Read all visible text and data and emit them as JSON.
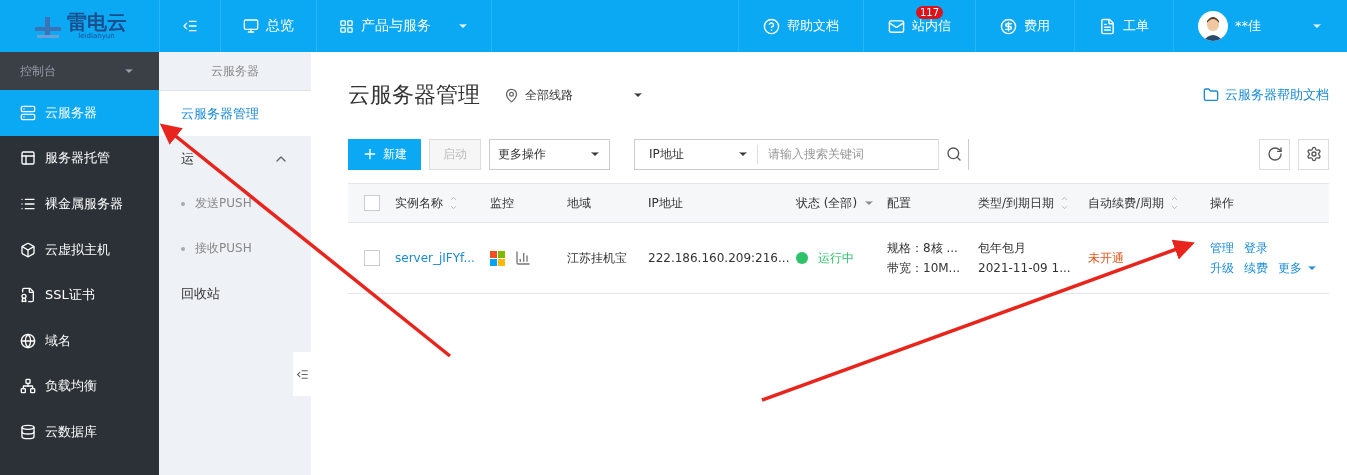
{
  "topbar": {
    "logo": {
      "name": "雷电云",
      "sub": "leidianyun"
    },
    "nav": [
      {
        "kind": "toggle"
      },
      {
        "kind": "link",
        "label": "总览"
      },
      {
        "kind": "dropdown",
        "label": "产品与服务"
      }
    ],
    "right": [
      {
        "label": "帮助文档"
      },
      {
        "label": "站内信",
        "badge": "117"
      },
      {
        "label": "费用"
      },
      {
        "label": "工单"
      }
    ],
    "user": {
      "name": "**佳"
    }
  },
  "sidebar": {
    "header": "控制台",
    "items": [
      {
        "label": "云服务器",
        "selected": true
      },
      {
        "label": "服务器托管",
        "selected": false
      },
      {
        "label": "裸金属服务器",
        "selected": false
      },
      {
        "label": "云虚拟主机",
        "selected": false
      },
      {
        "label": "SSL证书",
        "selected": false
      },
      {
        "label": "域名",
        "selected": false
      },
      {
        "label": "负载均衡",
        "selected": false
      },
      {
        "label": "云数据库",
        "selected": false
      }
    ]
  },
  "subnav": {
    "title": "云服务器",
    "items": [
      {
        "kind": "link",
        "label": "云服务器管理",
        "selected": true
      },
      {
        "kind": "group",
        "label": "运",
        "expanded": true,
        "children": [
          {
            "label": "发送PUSH"
          },
          {
            "label": "接收PUSH"
          }
        ]
      },
      {
        "kind": "link",
        "label": "回收站",
        "selected": false
      }
    ]
  },
  "main": {
    "title": "云服务器管理",
    "region": "全部线路",
    "help_link": "云服务器帮助文档",
    "toolbar": {
      "create": "新建",
      "start": {
        "label": "启动",
        "disabled": true
      },
      "more": "更多操作",
      "filter": "IP地址",
      "search": {
        "placeholder": "请输入搜索关键词"
      }
    },
    "table": {
      "select_all": {
        "checked": false
      },
      "columns": [
        {
          "label": "实例名称",
          "sortable": true
        },
        {
          "label": "监控",
          "sortable": false
        },
        {
          "label": "地域",
          "sortable": false
        },
        {
          "label": "IP地址",
          "sortable": false
        },
        {
          "label": "状态 (全部)",
          "sortable": false,
          "filter": true
        },
        {
          "label": "配置",
          "sortable": false
        },
        {
          "label": "类型/到期日期",
          "sortable": true
        },
        {
          "label": "自动续费/周期",
          "sortable": true
        },
        {
          "label": "操作",
          "sortable": false
        }
      ],
      "rows": [
        {
          "checked": false,
          "name": "server_jIFYf...",
          "region": "江苏挂机宝",
          "ip": "222.186.160.209:216...",
          "status": {
            "label": "运行中",
            "color": "#2ec26a"
          },
          "config": [
            "规格：8核 ...",
            "带宽：10M..."
          ],
          "type": [
            "包年包月",
            "2021-11-09 1..."
          ],
          "renew": "未开通",
          "actions": [
            [
              {
                "label": "管理",
                "dropdown": false
              },
              {
                "label": "登录",
                "dropdown": false
              }
            ],
            [
              {
                "label": "升级",
                "dropdown": false
              },
              {
                "label": "续费",
                "dropdown": false
              },
              {
                "label": "更多",
                "dropdown": true
              }
            ]
          ]
        }
      ]
    }
  }
}
